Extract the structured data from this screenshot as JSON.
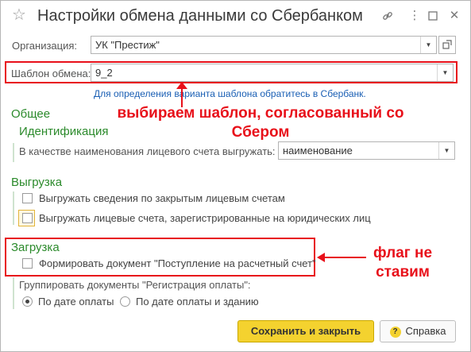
{
  "window": {
    "title": "Настройки обмена данными со Сбербанком",
    "controls": [
      "link-icon",
      "more-icon",
      "maximize-icon",
      "close-icon"
    ]
  },
  "form": {
    "organization": {
      "label": "Организация:",
      "value": "УК \"Престиж\""
    },
    "template": {
      "label": "Шаблон обмена:",
      "value": "9_2"
    },
    "hint": "Для определения варианта шаблона обратитесь в Сбербанк."
  },
  "general": {
    "title": "Общее",
    "identification": {
      "title": "Идентификация",
      "label": "В качестве наименования лицевого счета выгружать:",
      "value": "наименование"
    }
  },
  "export": {
    "title": "Выгрузка",
    "options": [
      {
        "label": "Выгружать сведения по закрытым лицевым счетам",
        "checked": false
      },
      {
        "label": "Выгружать лицевые счета, зарегистрированные на юридических лиц",
        "checked": false
      }
    ]
  },
  "import": {
    "title": "Загрузка",
    "option": {
      "label": "Формировать документ \"Поступление на расчетный счет\"",
      "checked": false
    },
    "group_label": "Группировать документы \"Регистрация оплаты\":",
    "radios": [
      {
        "label": "По дате оплаты",
        "selected": true
      },
      {
        "label": "По дате оплаты и зданию",
        "selected": false
      }
    ]
  },
  "buttons": {
    "save_close": "Сохранить и закрыть",
    "help": "Справка"
  },
  "annotations": {
    "template_note": "выбираем шаблон, согласованный со Сбером",
    "flag_note": "флаг не ставим",
    "color": "#e8101a"
  }
}
